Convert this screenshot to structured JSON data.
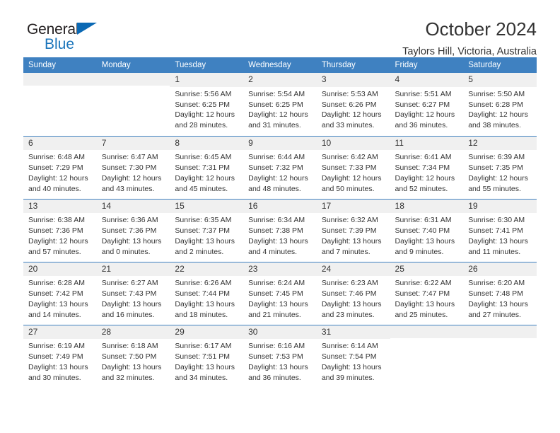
{
  "brand": {
    "name_top": "General",
    "name_bottom": "Blue",
    "triangle_color": "#0b69b4",
    "text_color": "#231f20",
    "blue_color": "#1b75bb"
  },
  "header": {
    "title": "October 2024",
    "subtitle": "Taylors Hill, Victoria, Australia",
    "accent_color": "#3f81c1"
  },
  "calendar": {
    "weekdays": [
      "Sunday",
      "Monday",
      "Tuesday",
      "Wednesday",
      "Thursday",
      "Friday",
      "Saturday"
    ],
    "weeks": [
      [
        {
          "day": "",
          "sunrise": "",
          "sunset": "",
          "daylight": ""
        },
        {
          "day": "",
          "sunrise": "",
          "sunset": "",
          "daylight": ""
        },
        {
          "day": "1",
          "sunrise": "Sunrise: 5:56 AM",
          "sunset": "Sunset: 6:25 PM",
          "daylight": "Daylight: 12 hours and 28 minutes."
        },
        {
          "day": "2",
          "sunrise": "Sunrise: 5:54 AM",
          "sunset": "Sunset: 6:25 PM",
          "daylight": "Daylight: 12 hours and 31 minutes."
        },
        {
          "day": "3",
          "sunrise": "Sunrise: 5:53 AM",
          "sunset": "Sunset: 6:26 PM",
          "daylight": "Daylight: 12 hours and 33 minutes."
        },
        {
          "day": "4",
          "sunrise": "Sunrise: 5:51 AM",
          "sunset": "Sunset: 6:27 PM",
          "daylight": "Daylight: 12 hours and 36 minutes."
        },
        {
          "day": "5",
          "sunrise": "Sunrise: 5:50 AM",
          "sunset": "Sunset: 6:28 PM",
          "daylight": "Daylight: 12 hours and 38 minutes."
        }
      ],
      [
        {
          "day": "6",
          "sunrise": "Sunrise: 6:48 AM",
          "sunset": "Sunset: 7:29 PM",
          "daylight": "Daylight: 12 hours and 40 minutes."
        },
        {
          "day": "7",
          "sunrise": "Sunrise: 6:47 AM",
          "sunset": "Sunset: 7:30 PM",
          "daylight": "Daylight: 12 hours and 43 minutes."
        },
        {
          "day": "8",
          "sunrise": "Sunrise: 6:45 AM",
          "sunset": "Sunset: 7:31 PM",
          "daylight": "Daylight: 12 hours and 45 minutes."
        },
        {
          "day": "9",
          "sunrise": "Sunrise: 6:44 AM",
          "sunset": "Sunset: 7:32 PM",
          "daylight": "Daylight: 12 hours and 48 minutes."
        },
        {
          "day": "10",
          "sunrise": "Sunrise: 6:42 AM",
          "sunset": "Sunset: 7:33 PM",
          "daylight": "Daylight: 12 hours and 50 minutes."
        },
        {
          "day": "11",
          "sunrise": "Sunrise: 6:41 AM",
          "sunset": "Sunset: 7:34 PM",
          "daylight": "Daylight: 12 hours and 52 minutes."
        },
        {
          "day": "12",
          "sunrise": "Sunrise: 6:39 AM",
          "sunset": "Sunset: 7:35 PM",
          "daylight": "Daylight: 12 hours and 55 minutes."
        }
      ],
      [
        {
          "day": "13",
          "sunrise": "Sunrise: 6:38 AM",
          "sunset": "Sunset: 7:36 PM",
          "daylight": "Daylight: 12 hours and 57 minutes."
        },
        {
          "day": "14",
          "sunrise": "Sunrise: 6:36 AM",
          "sunset": "Sunset: 7:36 PM",
          "daylight": "Daylight: 13 hours and 0 minutes."
        },
        {
          "day": "15",
          "sunrise": "Sunrise: 6:35 AM",
          "sunset": "Sunset: 7:37 PM",
          "daylight": "Daylight: 13 hours and 2 minutes."
        },
        {
          "day": "16",
          "sunrise": "Sunrise: 6:34 AM",
          "sunset": "Sunset: 7:38 PM",
          "daylight": "Daylight: 13 hours and 4 minutes."
        },
        {
          "day": "17",
          "sunrise": "Sunrise: 6:32 AM",
          "sunset": "Sunset: 7:39 PM",
          "daylight": "Daylight: 13 hours and 7 minutes."
        },
        {
          "day": "18",
          "sunrise": "Sunrise: 6:31 AM",
          "sunset": "Sunset: 7:40 PM",
          "daylight": "Daylight: 13 hours and 9 minutes."
        },
        {
          "day": "19",
          "sunrise": "Sunrise: 6:30 AM",
          "sunset": "Sunset: 7:41 PM",
          "daylight": "Daylight: 13 hours and 11 minutes."
        }
      ],
      [
        {
          "day": "20",
          "sunrise": "Sunrise: 6:28 AM",
          "sunset": "Sunset: 7:42 PM",
          "daylight": "Daylight: 13 hours and 14 minutes."
        },
        {
          "day": "21",
          "sunrise": "Sunrise: 6:27 AM",
          "sunset": "Sunset: 7:43 PM",
          "daylight": "Daylight: 13 hours and 16 minutes."
        },
        {
          "day": "22",
          "sunrise": "Sunrise: 6:26 AM",
          "sunset": "Sunset: 7:44 PM",
          "daylight": "Daylight: 13 hours and 18 minutes."
        },
        {
          "day": "23",
          "sunrise": "Sunrise: 6:24 AM",
          "sunset": "Sunset: 7:45 PM",
          "daylight": "Daylight: 13 hours and 21 minutes."
        },
        {
          "day": "24",
          "sunrise": "Sunrise: 6:23 AM",
          "sunset": "Sunset: 7:46 PM",
          "daylight": "Daylight: 13 hours and 23 minutes."
        },
        {
          "day": "25",
          "sunrise": "Sunrise: 6:22 AM",
          "sunset": "Sunset: 7:47 PM",
          "daylight": "Daylight: 13 hours and 25 minutes."
        },
        {
          "day": "26",
          "sunrise": "Sunrise: 6:20 AM",
          "sunset": "Sunset: 7:48 PM",
          "daylight": "Daylight: 13 hours and 27 minutes."
        }
      ],
      [
        {
          "day": "27",
          "sunrise": "Sunrise: 6:19 AM",
          "sunset": "Sunset: 7:49 PM",
          "daylight": "Daylight: 13 hours and 30 minutes."
        },
        {
          "day": "28",
          "sunrise": "Sunrise: 6:18 AM",
          "sunset": "Sunset: 7:50 PM",
          "daylight": "Daylight: 13 hours and 32 minutes."
        },
        {
          "day": "29",
          "sunrise": "Sunrise: 6:17 AM",
          "sunset": "Sunset: 7:51 PM",
          "daylight": "Daylight: 13 hours and 34 minutes."
        },
        {
          "day": "30",
          "sunrise": "Sunrise: 6:16 AM",
          "sunset": "Sunset: 7:53 PM",
          "daylight": "Daylight: 13 hours and 36 minutes."
        },
        {
          "day": "31",
          "sunrise": "Sunrise: 6:14 AM",
          "sunset": "Sunset: 7:54 PM",
          "daylight": "Daylight: 13 hours and 39 minutes."
        },
        {
          "day": "",
          "sunrise": "",
          "sunset": "",
          "daylight": ""
        },
        {
          "day": "",
          "sunrise": "",
          "sunset": "",
          "daylight": ""
        }
      ]
    ]
  }
}
